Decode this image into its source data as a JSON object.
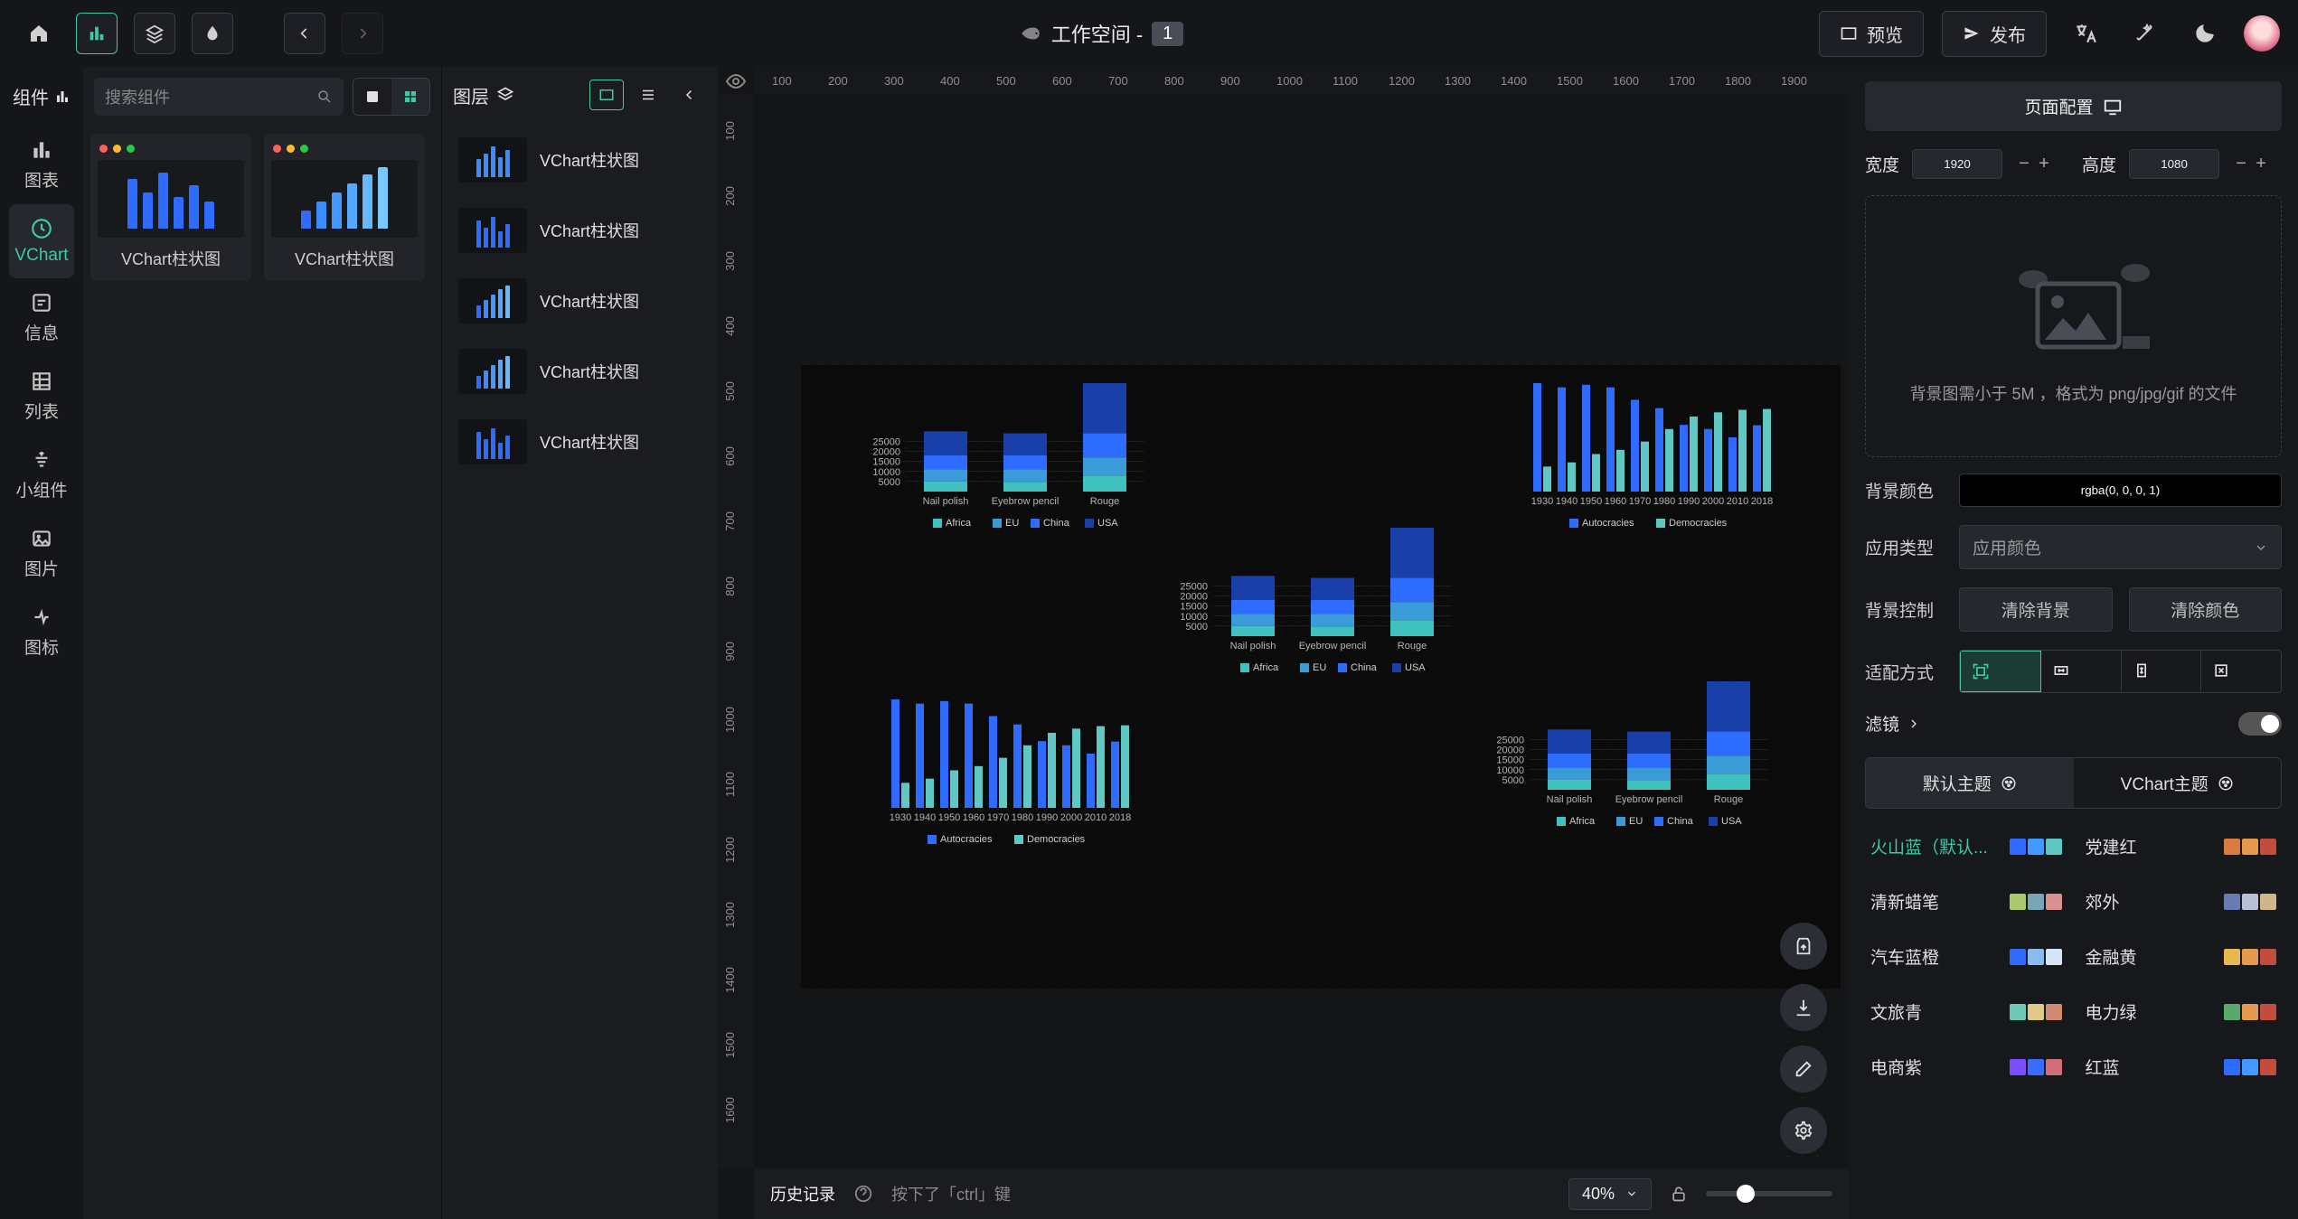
{
  "topbar": {
    "workspace_label": "工作空间 -",
    "workspace_seq": "1",
    "preview": "预览",
    "publish": "发布"
  },
  "category": {
    "title": "组件",
    "items": [
      {
        "label": "图表"
      },
      {
        "label": "VChart"
      },
      {
        "label": "信息"
      },
      {
        "label": "列表"
      },
      {
        "label": "小组件"
      },
      {
        "label": "图片"
      },
      {
        "label": "图标"
      }
    ]
  },
  "components": {
    "search_placeholder": "搜索组件",
    "cards": [
      {
        "name": "VChart柱状图"
      },
      {
        "name": "VChart柱状图"
      }
    ]
  },
  "layers": {
    "title": "图层",
    "items": [
      {
        "name": "VChart柱状图"
      },
      {
        "name": "VChart柱状图"
      },
      {
        "name": "VChart柱状图"
      },
      {
        "name": "VChart柱状图"
      },
      {
        "name": "VChart柱状图"
      }
    ]
  },
  "ruler_h": [
    "100",
    "200",
    "300",
    "400",
    "500",
    "600",
    "700",
    "800",
    "900",
    "1000",
    "1100",
    "1200",
    "1300",
    "1400",
    "1500",
    "1600",
    "1700",
    "1800",
    "1900"
  ],
  "ruler_v": [
    "100",
    "200",
    "300",
    "400",
    "500",
    "600",
    "700",
    "800",
    "900",
    "1000",
    "1100",
    "1200",
    "1300",
    "1400",
    "1500",
    "1600"
  ],
  "chart_data": [
    {
      "id": "bar-stacked-1",
      "type": "bar-stacked",
      "categories": [
        "Nail polish",
        "Eyebrow pencil",
        "Rouge"
      ],
      "series": [
        {
          "name": "Africa",
          "values": [
            5000,
            4500,
            8000
          ]
        },
        {
          "name": "EU",
          "values": [
            6000,
            6500,
            9000
          ]
        },
        {
          "name": "China",
          "values": [
            7000,
            7000,
            12000
          ]
        },
        {
          "name": "USA",
          "values": [
            12000,
            11000,
            25000
          ]
        }
      ],
      "yticks": [
        5000,
        10000,
        15000,
        20000,
        25000
      ]
    },
    {
      "id": "bar-stacked-2",
      "type": "bar-stacked",
      "categories": [
        "Nail polish",
        "Eyebrow pencil",
        "Rouge"
      ],
      "series": [
        {
          "name": "Africa",
          "values": [
            5000,
            4500,
            8000
          ]
        },
        {
          "name": "EU",
          "values": [
            6000,
            6500,
            9000
          ]
        },
        {
          "name": "China",
          "values": [
            7000,
            7000,
            12000
          ]
        },
        {
          "name": "USA",
          "values": [
            12000,
            11000,
            25000
          ]
        }
      ],
      "yticks": [
        5000,
        10000,
        15000,
        20000,
        25000
      ]
    },
    {
      "id": "bar-stacked-3",
      "type": "bar-stacked",
      "categories": [
        "Nail polish",
        "Eyebrow pencil",
        "Rouge"
      ],
      "series": [
        {
          "name": "Africa",
          "values": [
            5000,
            4500,
            8000
          ]
        },
        {
          "name": "EU",
          "values": [
            6000,
            6500,
            9000
          ]
        },
        {
          "name": "China",
          "values": [
            7000,
            7000,
            12000
          ]
        },
        {
          "name": "USA",
          "values": [
            12000,
            11000,
            25000
          ]
        }
      ],
      "yticks": [
        5000,
        10000,
        15000,
        20000,
        25000
      ]
    },
    {
      "id": "bar-years-1",
      "type": "bar-grouped",
      "categories": [
        "1930",
        "1940",
        "1950",
        "1960",
        "1970",
        "1980",
        "1990",
        "2000",
        "2010",
        "2018"
      ],
      "series": [
        {
          "name": "Autocracies",
          "values": [
            130,
            125,
            128,
            125,
            110,
            100,
            80,
            75,
            65,
            79.5
          ]
        },
        {
          "name": "Democracies",
          "values": [
            30,
            35,
            45,
            50,
            60,
            75,
            90,
            95,
            98,
            99
          ]
        }
      ],
      "yticks": []
    },
    {
      "id": "bar-years-2",
      "type": "bar-grouped",
      "categories": [
        "1930",
        "1940",
        "1950",
        "1960",
        "1970",
        "1980",
        "1990",
        "2000",
        "2010",
        "2018"
      ],
      "series": [
        {
          "name": "Autocracies",
          "values": [
            130,
            125,
            128,
            125,
            110,
            100,
            80,
            75,
            65,
            79.5
          ]
        },
        {
          "name": "Democracies",
          "values": [
            30,
            35,
            45,
            50,
            60,
            75,
            90,
            95,
            98,
            99
          ]
        }
      ],
      "yticks": []
    }
  ],
  "bottom": {
    "history": "历史记录",
    "tip_prefix": "按下了",
    "tip_key": "「ctrl」",
    "tip_suffix": "键",
    "zoom": "40%"
  },
  "inspector": {
    "heading": "页面配置",
    "width_label": "宽度",
    "width": "1920",
    "height_label": "高度",
    "height": "1080",
    "bg_upload_note": "背景图需小于 5M ，格式为 png/jpg/gif 的文件",
    "bg_color_label": "背景颜色",
    "bg_color_value": "rgba(0, 0, 0, 1)",
    "app_type_label": "应用类型",
    "app_type_placeholder": "应用颜色",
    "bg_control_label": "背景控制",
    "clear_bg": "清除背景",
    "clear_color": "清除颜色",
    "fit_mode_label": "适配方式",
    "filter_label": "滤镜",
    "theme_tab1": "默认主题",
    "theme_tab2": "VChart主题",
    "themes": [
      {
        "name": "火山蓝（默认...",
        "colors": [
          "#2e6cff",
          "#4299ff",
          "#5ec9c3"
        ],
        "selected": true
      },
      {
        "name": "党建红",
        "colors": [
          "#d97a3e",
          "#e69a4e",
          "#c24d3d"
        ]
      },
      {
        "name": "清新蜡笔",
        "colors": [
          "#a9c96a",
          "#79a6b7",
          "#d89090"
        ]
      },
      {
        "name": "郊外",
        "colors": [
          "#6a7bb3",
          "#b7c0d6",
          "#d2b48a"
        ]
      },
      {
        "name": "汽车蓝橙",
        "colors": [
          "#2e6cff",
          "#8bbbee",
          "#d6e4f7"
        ]
      },
      {
        "name": "金融黄",
        "colors": [
          "#e6b84e",
          "#e69a4e",
          "#c24d3d"
        ]
      },
      {
        "name": "文旅青",
        "colors": [
          "#6fc9b5",
          "#e0c98b",
          "#d08b6e"
        ]
      },
      {
        "name": "电力绿",
        "colors": [
          "#5aa96b",
          "#e69a4e",
          "#c24d3d"
        ]
      },
      {
        "name": "电商紫",
        "colors": [
          "#7a4eff",
          "#3a6cff",
          "#d06e7a"
        ]
      },
      {
        "name": "红蓝",
        "colors": [
          "#2e6cff",
          "#4299ff",
          "#c24d3d"
        ]
      }
    ]
  }
}
